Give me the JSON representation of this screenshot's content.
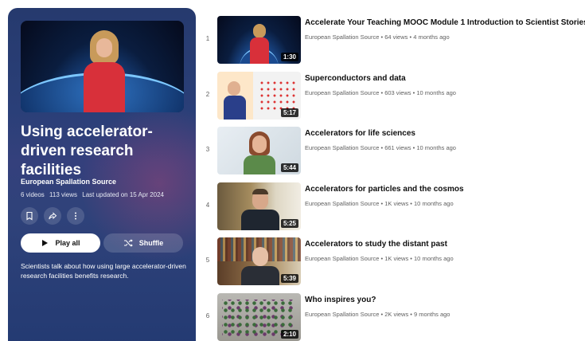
{
  "playlist": {
    "title": "Using accelerator-driven research facilities",
    "channel": "European Spallation Source",
    "video_count": "6 videos",
    "views": "113 views",
    "updated": "Last updated on 15 Apr 2024",
    "play_all_label": "Play all",
    "shuffle_label": "Shuffle",
    "description": "Scientists talk about how using large accelerator-driven research facilities benefits research.",
    "icons": [
      "bookmark-icon",
      "share-icon",
      "more-icon",
      "play-icon",
      "shuffle-icon"
    ]
  },
  "videos": [
    {
      "index": "1",
      "title": "Accelerate Your Teaching MOOC Module 1 Introduction to Scientist Stories",
      "duration": "1:30",
      "channel": "European Spallation Source",
      "views": "64 views",
      "age": "4 months ago"
    },
    {
      "index": "2",
      "title": "Superconductors and data",
      "duration": "5:17",
      "channel": "European Spallation Source",
      "views": "603 views",
      "age": "10 months ago"
    },
    {
      "index": "3",
      "title": "Accelerators for life sciences",
      "duration": "5:44",
      "channel": "European Spallation Source",
      "views": "661 views",
      "age": "10 months ago"
    },
    {
      "index": "4",
      "title": "Accelerators for particles and the cosmos",
      "duration": "5:25",
      "channel": "European Spallation Source",
      "views": "1K views",
      "age": "10 months ago"
    },
    {
      "index": "5",
      "title": "Accelerators to study the distant past",
      "duration": "5:39",
      "channel": "European Spallation Source",
      "views": "1K views",
      "age": "10 months ago"
    },
    {
      "index": "6",
      "title": "Who inspires you?",
      "duration": "2:10",
      "channel": "European Spallation Source",
      "views": "2K views",
      "age": "9 months ago"
    }
  ],
  "colors": {
    "panel": "#2a3f78",
    "accent": "#ffffff",
    "text_secondary": "#606060"
  }
}
